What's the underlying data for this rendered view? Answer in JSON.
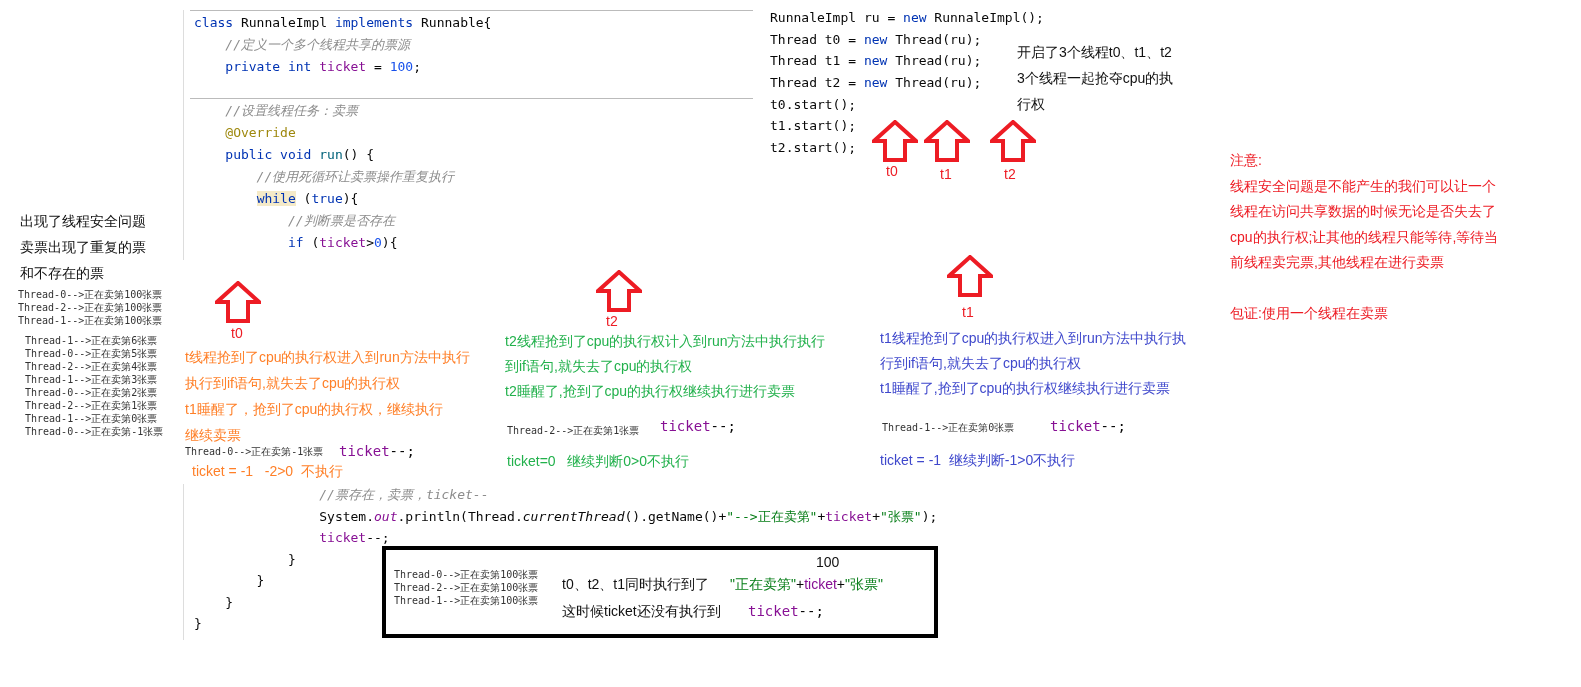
{
  "main_code_top": {
    "sections": [
      {
        "lines": [
          [
            {
              "kind": "kw",
              "text": "class"
            },
            {
              "kind": "pl",
              "text": " RunnaleImpl "
            },
            {
              "kind": "kw",
              "text": "implements"
            },
            {
              "kind": "pl",
              "text": " Runnable{"
            }
          ],
          [
            {
              "kind": "cm",
              "text": "    //定义一个多个线程共享的票源"
            }
          ],
          [
            {
              "kind": "kw",
              "text": "    private int "
            },
            {
              "kind": "fd",
              "text": "ticket"
            },
            {
              "kind": "pl",
              "text": " = "
            },
            {
              "kind": "num",
              "text": "100"
            },
            {
              "kind": "pl",
              "text": ";"
            }
          ]
        ]
      },
      {
        "lines": [
          [
            {
              "kind": "cm",
              "text": "    //设置线程任务：卖票"
            }
          ],
          [
            {
              "kind": "ann",
              "text": "    @Override"
            }
          ],
          [
            {
              "kind": "kw",
              "text": "    public void "
            },
            {
              "kind": "mt",
              "text": "run"
            },
            {
              "kind": "pl",
              "text": "() {"
            }
          ],
          [
            {
              "kind": "cm",
              "text": "        //使用死循环让卖票操作重复执行"
            }
          ],
          [
            {
              "kind": "hl",
              "text": "        while"
            },
            {
              "kind": "pl",
              "text": " ("
            },
            {
              "kind": "kw",
              "text": "true"
            },
            {
              "kind": "pl",
              "text": "){"
            }
          ],
          [
            {
              "kind": "cm",
              "text": "            //判断票是否存在"
            }
          ],
          [
            {
              "kind": "kw",
              "text": "            if"
            },
            {
              "kind": "pl",
              "text": " ("
            },
            {
              "kind": "fd",
              "text": "ticket"
            },
            {
              "kind": "pl",
              "text": ">"
            },
            {
              "kind": "num",
              "text": "0"
            },
            {
              "kind": "pl",
              "text": "){"
            }
          ]
        ]
      }
    ]
  },
  "left_note": [
    "出现了线程安全问题",
    "卖票出现了重复的票",
    "和不存在的票"
  ],
  "console_a": [
    "Thread-0-->正在卖第100张票",
    "Thread-2-->正在卖第100张票",
    "Thread-1-->正在卖第100张票"
  ],
  "console_b": [
    "Thread-1-->正在卖第6张票",
    "Thread-0-->正在卖第5张票",
    "Thread-2-->正在卖第4张票",
    "Thread-1-->正在卖第3张票",
    "Thread-0-->正在卖第2张票",
    "Thread-2-->正在卖第1张票",
    "Thread-1-->正在卖第0张票",
    "Thread-0-->正在卖第-1张票"
  ],
  "start_code": [
    [
      {
        "kind": "pl",
        "text": "RunnaleImpl ru = "
      },
      {
        "kind": "kw",
        "text": "new"
      },
      {
        "kind": "pl",
        "text": " RunnaleImpl();"
      }
    ],
    [
      {
        "kind": "pl",
        "text": "Thread t0 = "
      },
      {
        "kind": "kw",
        "text": "new"
      },
      {
        "kind": "pl",
        "text": " Thread(ru);"
      }
    ],
    [
      {
        "kind": "pl",
        "text": "Thread t1 = "
      },
      {
        "kind": "kw",
        "text": "new"
      },
      {
        "kind": "pl",
        "text": " Thread(ru);"
      }
    ],
    [
      {
        "kind": "pl",
        "text": "Thread t2 = "
      },
      {
        "kind": "kw",
        "text": "new"
      },
      {
        "kind": "pl",
        "text": " Thread(ru);"
      }
    ],
    [
      {
        "kind": "pl",
        "text": "t0.start();"
      }
    ],
    [
      {
        "kind": "pl",
        "text": "t1.start();"
      }
    ],
    [
      {
        "kind": "pl",
        "text": "t2.start();"
      }
    ]
  ],
  "start_note": [
    "开启了3个线程t0、t1、t2",
    "3个线程一起抢夺cpu的执",
    "行权"
  ],
  "top_arrows": [
    "t0",
    "t1",
    "t2"
  ],
  "warning_note": [
    [
      "注意:",
      "线程安全问题是不能产生的我们可以让一个",
      "线程在访问共享数据的时候无论是否失去了",
      "cpu的执行权;让其他的线程只能等待,等待当",
      "前线程卖完票,其他线程在进行卖票"
    ],
    [
      "包证:使用一个线程在卖票"
    ]
  ],
  "threads": [
    {
      "arrow_label": "t0",
      "note": [
        "t线程抢到了cpu的执行权进入到run方法中执行",
        "执行到if语句,就失去了cpu的执行权",
        "t1睡醒了，抢到了cpu的执行权，继续执行",
        "继续卖票"
      ],
      "console": "Thread-0-->正在卖第-1张票",
      "code": [
        {
          "kind": "fd",
          "text": "ticket"
        },
        {
          "kind": "pl",
          "text": "--;"
        }
      ],
      "result": "ticket = -1   -2>0  不执行",
      "color": "#ff7f27"
    },
    {
      "arrow_label": "t2",
      "note": [
        "t2线程抢到了cpu的执行权计入到run方法中执行执行",
        "到if语句,就失去了cpu的执行权",
        "t2睡醒了,抢到了cpu的执行权继续执行进行卖票"
      ],
      "console": "Thread-2-->正在卖第1张票",
      "code": [
        {
          "kind": "fd",
          "text": "ticket"
        },
        {
          "kind": "pl",
          "text": "--;"
        }
      ],
      "result": "ticket=0   继续判断0>0不执行",
      "color": "#22b14c"
    },
    {
      "arrow_label": "t1",
      "note": [
        "t1线程抢到了cpu的执行权进入到run方法中执行执",
        "行到if语句,就失去了cpu的执行权",
        "t1睡醒了,抢到了cpu的执行权继续执行进行卖票"
      ],
      "console": "Thread-1-->正在卖第0张票",
      "code": [
        {
          "kind": "fd",
          "text": "ticket"
        },
        {
          "kind": "pl",
          "text": "--;"
        }
      ],
      "result": "ticket = -1  继续判断-1>0不执行",
      "color": "#3f48cc"
    }
  ],
  "main_code_bottom": [
    [
      {
        "kind": "cm",
        "text": "                //票存在，卖票，ticket--"
      }
    ],
    [
      {
        "kind": "pl",
        "text": "                System."
      },
      {
        "kind": "fi",
        "text": "out"
      },
      {
        "kind": "pl",
        "text": ".println(Thread."
      },
      {
        "kind": "it",
        "text": "currentThread"
      },
      {
        "kind": "pl",
        "text": "().getName()+"
      },
      {
        "kind": "str",
        "text": "\"-->正在卖第\""
      },
      {
        "kind": "pl",
        "text": "+"
      },
      {
        "kind": "fd",
        "text": "ticket"
      },
      {
        "kind": "pl",
        "text": "+"
      },
      {
        "kind": "str",
        "text": "\"张票\""
      },
      {
        "kind": "pl",
        "text": ");"
      }
    ],
    [
      {
        "kind": "fd",
        "text": "                ticket"
      },
      {
        "kind": "pl",
        "text": "--;"
      }
    ],
    [
      {
        "kind": "pl",
        "text": "            }"
      }
    ],
    [
      {
        "kind": "pl",
        "text": "        }"
      }
    ],
    [
      {
        "kind": "pl",
        "text": "    }"
      }
    ],
    [
      {
        "kind": "pl",
        "text": "}"
      }
    ]
  ],
  "callout": {
    "console": [
      "Thread-0-->正在卖第100张票",
      "Thread-2-->正在卖第100张票",
      "Thread-1-->正在卖第100张票"
    ],
    "value": "100",
    "line_1": "t0、t2、t1同时执行到了",
    "code_1": [
      {
        "kind": "str",
        "text": "\"正在卖第\""
      },
      {
        "kind": "pl",
        "text": "+"
      },
      {
        "kind": "fd",
        "text": "ticket"
      },
      {
        "kind": "pl",
        "text": "+"
      },
      {
        "kind": "str",
        "text": "\"张票\""
      }
    ],
    "line_2": "这时候ticket还没有执行到",
    "code_2": [
      {
        "kind": "fd",
        "text": "ticket"
      },
      {
        "kind": "pl",
        "text": "--;"
      }
    ]
  }
}
